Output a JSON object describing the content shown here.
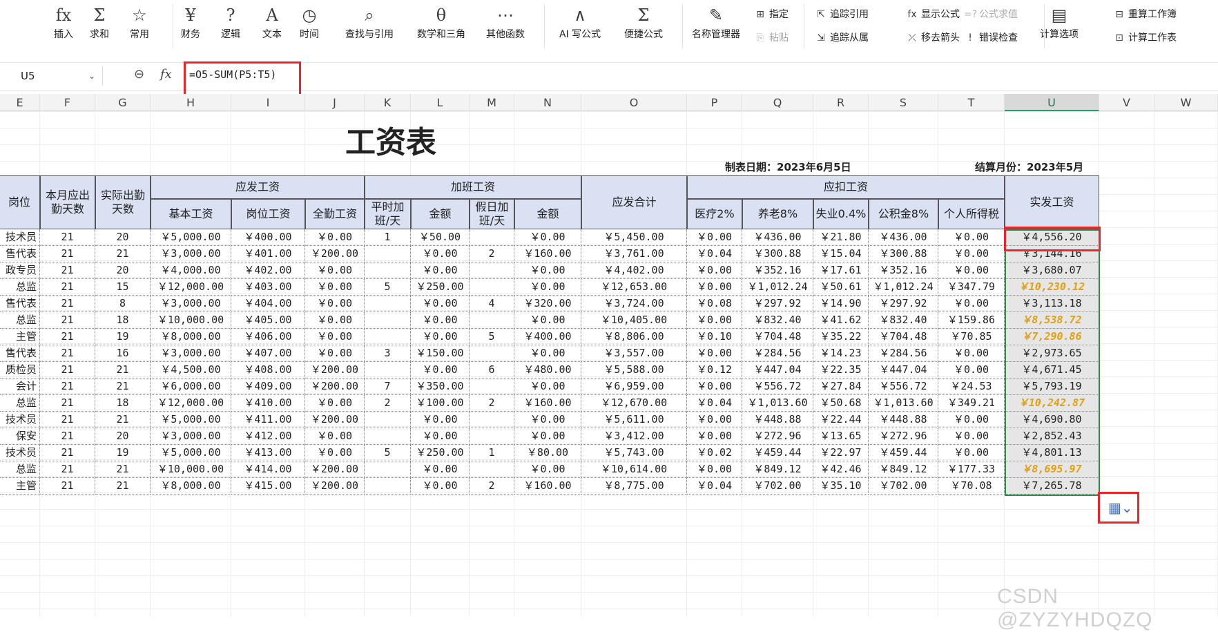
{
  "ribbon": {
    "big_buttons": [
      {
        "icon": "fx",
        "label": "插入"
      },
      {
        "icon": "Σ",
        "label": "求和"
      },
      {
        "icon": "☆",
        "label": "常用"
      },
      {
        "icon": "¥",
        "label": "财务"
      },
      {
        "icon": "?",
        "label": "逻辑"
      },
      {
        "icon": "A",
        "label": "文本"
      },
      {
        "icon": "◷",
        "label": "时间"
      },
      {
        "icon": "⌕",
        "label": "查找与引用"
      },
      {
        "icon": "θ",
        "label": "数学和三角"
      },
      {
        "icon": "⋯",
        "label": "其他函数"
      },
      {
        "icon": "∧",
        "label": "AI 写公式"
      },
      {
        "icon": "Σ",
        "label": "便捷公式"
      },
      {
        "icon": "✎",
        "label": "名称管理器"
      },
      {
        "icon": "▤",
        "label": "计算选项"
      }
    ],
    "small_buttons": [
      {
        "icon": "⊞",
        "label": "指定",
        "disabled": false
      },
      {
        "icon": "⎘",
        "label": "粘贴",
        "disabled": true
      },
      {
        "icon": "⇱",
        "label": "追踪引用",
        "disabled": false
      },
      {
        "icon": "⇲",
        "label": "追踪从属",
        "disabled": false
      },
      {
        "icon": "fx",
        "label": "显示公式",
        "disabled": false
      },
      {
        "icon": "⤫",
        "label": "移去箭头",
        "disabled": false
      },
      {
        "icon": "=?",
        "label": "公式求值",
        "disabled": true
      },
      {
        "icon": "!",
        "label": "错误检查",
        "disabled": false
      },
      {
        "icon": "⊟",
        "label": "重算工作簿",
        "disabled": false
      },
      {
        "icon": "⊡",
        "label": "计算工作表",
        "disabled": false
      }
    ]
  },
  "formula_bar": {
    "name_box": "U5",
    "fx": "fx",
    "formula": "=O5-SUM(P5:T5)"
  },
  "columns": [
    "E",
    "F",
    "G",
    "H",
    "I",
    "J",
    "K",
    "L",
    "M",
    "N",
    "O",
    "P",
    "Q",
    "R",
    "S",
    "T",
    "U",
    "V",
    "W"
  ],
  "selected_column": "U",
  "sheet": {
    "title": "工资表",
    "date_label": "制表日期：2023年6月5日",
    "month_label": "结算月份：2023年5月",
    "headers": {
      "position": "岗位",
      "required_days": "本月应出勤天数",
      "actual_days": "实际出勤天数",
      "group_payable": "应发工资",
      "base": "基本工资",
      "post": "岗位工资",
      "attendance": "全勤工资",
      "group_overtime": "加班工资",
      "ot_weekday": "平时加班/天",
      "ot_weekday_amount": "金额",
      "ot_holiday": "假日加班/天",
      "ot_holiday_amount": "金额",
      "total_payable": "应发合计",
      "group_deductions": "应扣工资",
      "medical": "医疗2%",
      "pension": "养老8%",
      "unemployment": "失业0.4%",
      "housing": "公积金8%",
      "tax": "个人所得税",
      "net": "实发工资"
    },
    "rows": [
      [
        "技术员",
        "21",
        "20",
        "￥5,000.00",
        "￥400.00",
        "￥0.00",
        "1",
        "￥50.00",
        "",
        "￥0.00",
        "￥5,450.00",
        "￥0.00",
        "￥436.00",
        "￥21.80",
        "￥436.00",
        "￥0.00",
        "￥4,556.20",
        false
      ],
      [
        "售代表",
        "21",
        "21",
        "￥3,000.00",
        "￥401.00",
        "￥200.00",
        "",
        "￥0.00",
        "2",
        "￥160.00",
        "￥3,761.00",
        "￥0.04",
        "￥300.88",
        "￥15.04",
        "￥300.88",
        "￥0.00",
        "￥3,144.16",
        false
      ],
      [
        "政专员",
        "21",
        "20",
        "￥4,000.00",
        "￥402.00",
        "￥0.00",
        "",
        "￥0.00",
        "",
        "￥0.00",
        "￥4,402.00",
        "￥0.00",
        "￥352.16",
        "￥17.61",
        "￥352.16",
        "￥0.00",
        "￥3,680.07",
        false
      ],
      [
        "总监",
        "21",
        "15",
        "￥12,000.00",
        "￥403.00",
        "￥0.00",
        "5",
        "￥250.00",
        "",
        "￥0.00",
        "￥12,653.00",
        "￥0.00",
        "￥1,012.24",
        "￥50.61",
        "￥1,012.24",
        "￥347.79",
        "￥10,230.12",
        true
      ],
      [
        "售代表",
        "21",
        "8",
        "￥3,000.00",
        "￥404.00",
        "￥0.00",
        "",
        "￥0.00",
        "4",
        "￥320.00",
        "￥3,724.00",
        "￥0.08",
        "￥297.92",
        "￥14.90",
        "￥297.92",
        "￥0.00",
        "￥3,113.18",
        false
      ],
      [
        "总监",
        "21",
        "18",
        "￥10,000.00",
        "￥405.00",
        "￥0.00",
        "",
        "￥0.00",
        "",
        "￥0.00",
        "￥10,405.00",
        "￥0.00",
        "￥832.40",
        "￥41.62",
        "￥832.40",
        "￥159.86",
        "￥8,538.72",
        true
      ],
      [
        "主管",
        "21",
        "19",
        "￥8,000.00",
        "￥406.00",
        "￥0.00",
        "",
        "￥0.00",
        "5",
        "￥400.00",
        "￥8,806.00",
        "￥0.10",
        "￥704.48",
        "￥35.22",
        "￥704.48",
        "￥70.85",
        "￥7,290.86",
        true
      ],
      [
        "售代表",
        "21",
        "16",
        "￥3,000.00",
        "￥407.00",
        "￥0.00",
        "3",
        "￥150.00",
        "",
        "￥0.00",
        "￥3,557.00",
        "￥0.00",
        "￥284.56",
        "￥14.23",
        "￥284.56",
        "￥0.00",
        "￥2,973.65",
        false
      ],
      [
        "质检员",
        "21",
        "21",
        "￥4,500.00",
        "￥408.00",
        "￥200.00",
        "",
        "￥0.00",
        "6",
        "￥480.00",
        "￥5,588.00",
        "￥0.12",
        "￥447.04",
        "￥22.35",
        "￥447.04",
        "￥0.00",
        "￥4,671.45",
        false
      ],
      [
        "会计",
        "21",
        "21",
        "￥6,000.00",
        "￥409.00",
        "￥200.00",
        "7",
        "￥350.00",
        "",
        "￥0.00",
        "￥6,959.00",
        "￥0.00",
        "￥556.72",
        "￥27.84",
        "￥556.72",
        "￥24.53",
        "￥5,793.19",
        false
      ],
      [
        "总监",
        "21",
        "18",
        "￥12,000.00",
        "￥410.00",
        "￥0.00",
        "2",
        "￥100.00",
        "2",
        "￥160.00",
        "￥12,670.00",
        "￥0.04",
        "￥1,013.60",
        "￥50.68",
        "￥1,013.60",
        "￥349.21",
        "￥10,242.87",
        true
      ],
      [
        "技术员",
        "21",
        "21",
        "￥5,000.00",
        "￥411.00",
        "￥200.00",
        "",
        "￥0.00",
        "",
        "￥0.00",
        "￥5,611.00",
        "￥0.00",
        "￥448.88",
        "￥22.44",
        "￥448.88",
        "￥0.00",
        "￥4,690.80",
        false
      ],
      [
        "保安",
        "21",
        "20",
        "￥3,000.00",
        "￥412.00",
        "￥0.00",
        "",
        "￥0.00",
        "",
        "￥0.00",
        "￥3,412.00",
        "￥0.00",
        "￥272.96",
        "￥13.65",
        "￥272.96",
        "￥0.00",
        "￥2,852.43",
        false
      ],
      [
        "技术员",
        "21",
        "19",
        "￥5,000.00",
        "￥413.00",
        "￥0.00",
        "5",
        "￥250.00",
        "1",
        "￥80.00",
        "￥5,743.00",
        "￥0.02",
        "￥459.44",
        "￥22.97",
        "￥459.44",
        "￥0.00",
        "￥4,801.13",
        false
      ],
      [
        "总监",
        "21",
        "21",
        "￥10,000.00",
        "￥414.00",
        "￥200.00",
        "",
        "￥0.00",
        "",
        "￥0.00",
        "￥10,614.00",
        "￥0.00",
        "￥849.12",
        "￥42.46",
        "￥849.12",
        "￥177.33",
        "￥8,695.97",
        true
      ],
      [
        "主管",
        "21",
        "21",
        "￥8,000.00",
        "￥415.00",
        "￥200.00",
        "",
        "￥0.00",
        "2",
        "￥160.00",
        "￥8,775.00",
        "￥0.04",
        "￥702.00",
        "￥35.10",
        "￥702.00",
        "￥70.08",
        "￥7,265.78",
        false
      ]
    ]
  },
  "colors": {
    "highlight_gold": "#e2a011",
    "header_fill": "#d9e1f2",
    "annotation_red": "#e8262c",
    "selection_green": "#2f8b47"
  },
  "quick_analysis_icon": "quick-analysis-icon",
  "watermark": "CSDN @ZYZYHDQZQ"
}
